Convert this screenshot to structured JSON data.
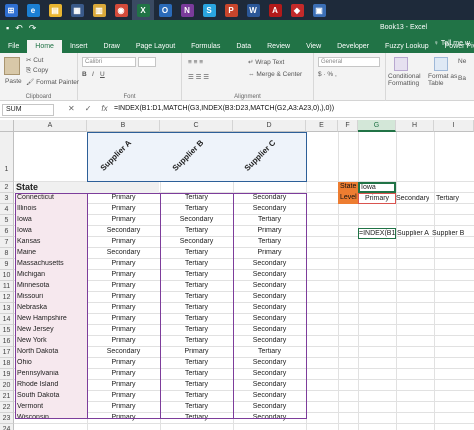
{
  "taskbar": {
    "apps": [
      {
        "name": "start",
        "color": "#2f6fd1",
        "glyph": "⊞"
      },
      {
        "name": "edge",
        "color": "#1b7fd3",
        "glyph": "e"
      },
      {
        "name": "file-explorer",
        "color": "#e8b530",
        "glyph": "▤"
      },
      {
        "name": "store",
        "color": "#3a5a8a",
        "glyph": "▦"
      },
      {
        "name": "folder",
        "color": "#d9a93a",
        "glyph": "▥"
      },
      {
        "name": "chrome",
        "color": "#d34a3a",
        "glyph": "◉"
      },
      {
        "name": "excel",
        "color": "#217346",
        "glyph": "X"
      },
      {
        "name": "outlook",
        "color": "#2a6ab8",
        "glyph": "O"
      },
      {
        "name": "onenote",
        "color": "#7a3b9b",
        "glyph": "N"
      },
      {
        "name": "skype",
        "color": "#2aa5e0",
        "glyph": "S"
      },
      {
        "name": "powerpoint",
        "color": "#c8452c",
        "glyph": "P"
      },
      {
        "name": "word",
        "color": "#2b5797",
        "glyph": "W"
      },
      {
        "name": "acrobat",
        "color": "#b21a1a",
        "glyph": "A"
      },
      {
        "name": "app-red",
        "color": "#c42a2a",
        "glyph": "◆"
      },
      {
        "name": "app-blue",
        "color": "#3c6fb6",
        "glyph": "▣"
      }
    ]
  },
  "window": {
    "title": "Book13 - Excel"
  },
  "ribbon": {
    "tabs": [
      "File",
      "Home",
      "Insert",
      "Draw",
      "Page Layout",
      "Formulas",
      "Data",
      "Review",
      "View",
      "Developer",
      "Fuzzy Lookup",
      "Power Pivot"
    ],
    "tell_me": "♀ Tell me w",
    "paste": "Paste",
    "cut": "Cut",
    "copy": "Copy",
    "format_painter": "Format Painter",
    "clipboard": "Clipboard",
    "font_name": "Calibri",
    "font": "Font",
    "wrap_text": "Wrap Text",
    "merge_center": "Merge & Center",
    "alignment": "Alignment",
    "number_format": "General",
    "conditional_formatting": "Conditional Formatting",
    "format_as_table": "Format as Table",
    "ne": "Ne",
    "ba": "Ba"
  },
  "formula_bar": {
    "name_box": "SUM",
    "formula": "=INDEX(B1:D1,MATCH(G3,INDEX(B3:D23,MATCH(G2,A3:A23,0),),0))"
  },
  "columns": [
    "A",
    "B",
    "C",
    "D",
    "E",
    "F",
    "G",
    "H",
    "I"
  ],
  "rows": [
    "1",
    "2",
    "3",
    "4",
    "5",
    "6",
    "7",
    "8",
    "9",
    "10",
    "11",
    "12",
    "13",
    "14",
    "15",
    "16",
    "17",
    "18",
    "19",
    "20",
    "21",
    "22",
    "23",
    "24"
  ],
  "suppliers": [
    "Supplier A",
    "Supplier B",
    "Supplier C"
  ],
  "state_header": "State",
  "table": [
    [
      "Connecticut",
      "Primary",
      "Tertiary",
      "Secondary"
    ],
    [
      "Illinois",
      "Primary",
      "Tertiary",
      "Secondary"
    ],
    [
      "Iowa",
      "Primary",
      "Secondary",
      "Tertiary"
    ],
    [
      "Iowa",
      "Secondary",
      "Tertiary",
      "Primary"
    ],
    [
      "Kansas",
      "Primary",
      "Secondary",
      "Tertiary"
    ],
    [
      "Maine",
      "Secondary",
      "Tertiary",
      "Primary"
    ],
    [
      "Massachusetts",
      "Primary",
      "Tertiary",
      "Secondary"
    ],
    [
      "Michigan",
      "Primary",
      "Tertiary",
      "Secondary"
    ],
    [
      "Minnesota",
      "Primary",
      "Tertiary",
      "Secondary"
    ],
    [
      "Missouri",
      "Primary",
      "Tertiary",
      "Secondary"
    ],
    [
      "Nebraska",
      "Primary",
      "Tertiary",
      "Secondary"
    ],
    [
      "New Hampshire",
      "Primary",
      "Tertiary",
      "Secondary"
    ],
    [
      "New Jersey",
      "Primary",
      "Tertiary",
      "Secondary"
    ],
    [
      "New York",
      "Primary",
      "Tertiary",
      "Secondary"
    ],
    [
      "North Dakota",
      "Secondary",
      "Primary",
      "Tertiary"
    ],
    [
      "Ohio",
      "Primary",
      "Tertiary",
      "Secondary"
    ],
    [
      "Pennsylvania",
      "Primary",
      "Tertiary",
      "Secondary"
    ],
    [
      "Rhode Island",
      "Primary",
      "Tertiary",
      "Secondary"
    ],
    [
      "South Dakota",
      "Primary",
      "Tertiary",
      "Secondary"
    ],
    [
      "Vermont",
      "Primary",
      "Tertiary",
      "Secondary"
    ],
    [
      "Wisconsin",
      "Primary",
      "Tertiary",
      "Secondary"
    ]
  ],
  "lookup": {
    "state_label": "State",
    "state_value": "Iowa",
    "level_label": "Level",
    "level_primary": "Primary",
    "level_secondary": "Secondary",
    "level_tertiary": "Tertiary",
    "edit_formula": "=INDEX(B1",
    "result_a": "Supplier A",
    "result_b": "Supplier B"
  },
  "colors": {
    "excel_green": "#217346",
    "orange_label": "#ed7d31",
    "purple_border": "#7d3d9b",
    "blue_border": "#2d5f98",
    "state_fill": "#f6e8ee"
  }
}
